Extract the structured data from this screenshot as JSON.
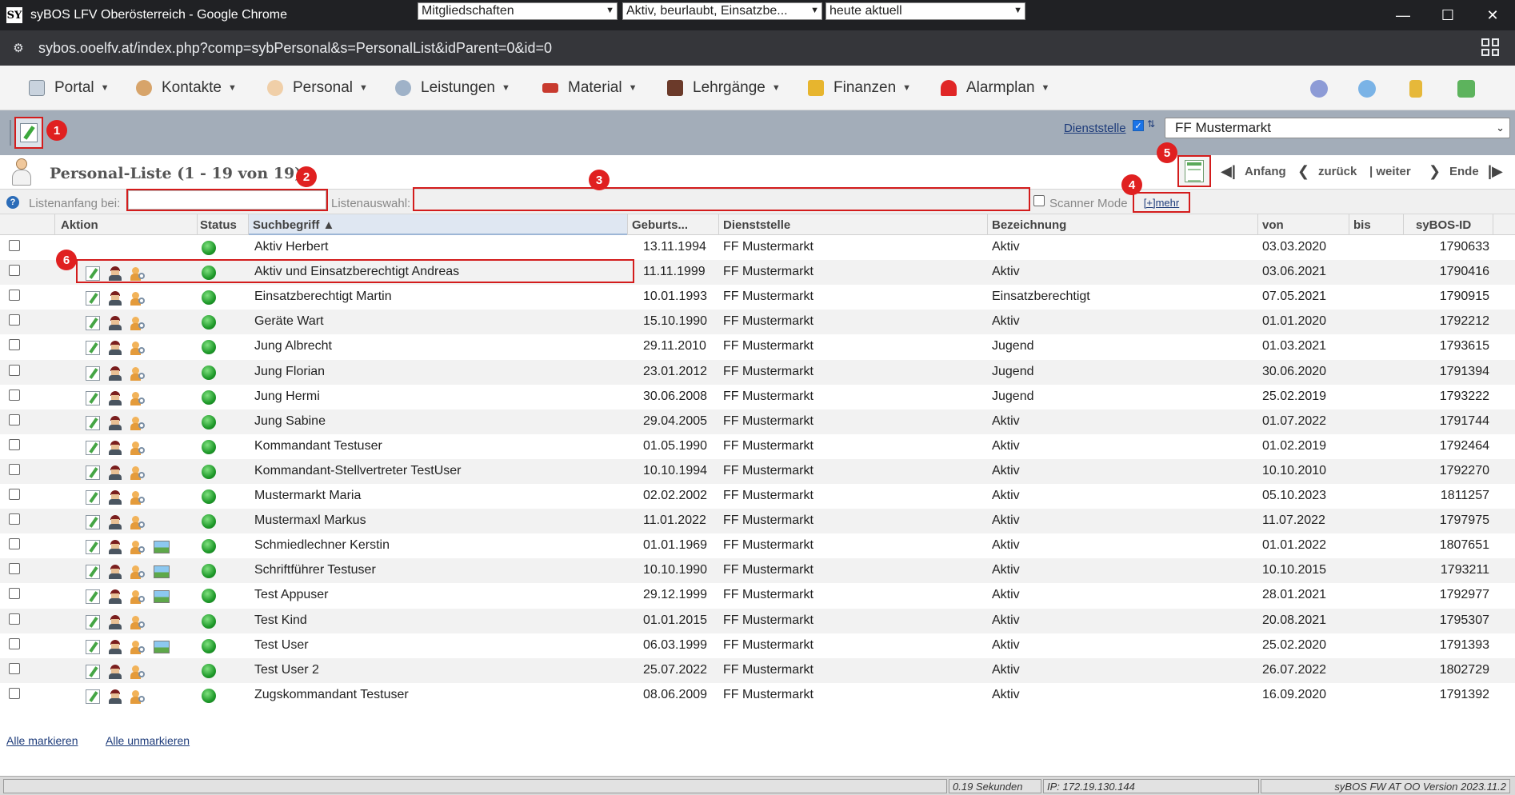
{
  "window": {
    "app_icon": "SY",
    "title": "syBOS LFV Oberösterreich - Google Chrome",
    "url": "sybos.ooelfv.at/index.php?comp=sybPersonal&s=PersonalList&idParent=0&id=0"
  },
  "menu": {
    "items": [
      {
        "label": "Portal",
        "icon": "portal-icon"
      },
      {
        "label": "Kontakte",
        "icon": "contacts-icon"
      },
      {
        "label": "Personal",
        "icon": "personal-icon"
      },
      {
        "label": "Leistungen",
        "icon": "services-icon"
      },
      {
        "label": "Material",
        "icon": "truck-icon"
      },
      {
        "label": "Lehrgänge",
        "icon": "course-icon"
      },
      {
        "label": "Finanzen",
        "icon": "finance-icon"
      },
      {
        "label": "Alarmplan",
        "icon": "alarm-icon"
      }
    ]
  },
  "toolbar": {
    "dienststelle_label": "Dienststelle",
    "dienststelle_value": "FF Mustermarkt",
    "tree_glyph": "⇅"
  },
  "list": {
    "title": "Personal-Liste (1 - 19 von 19)",
    "pager": {
      "first": "Anfang",
      "prev": "zurück",
      "next": "| weiter",
      "last": "Ende"
    }
  },
  "filter": {
    "start_label": "Listenanfang bei:",
    "start_value": "",
    "select_label": "Listenauswahl:",
    "select1": "Mitgliedschaften",
    "select2": "Aktiv, beurlaubt, Einsatzbe...",
    "select3": "heute aktuell",
    "scanner_label": "Scanner Mode",
    "more_label": "[+]mehr"
  },
  "table": {
    "headers": [
      "Aktion",
      "Status",
      "Suchbegriff ▲",
      "Geburts...",
      "Dienststelle",
      "Bezeichnung",
      "von",
      "bis",
      "syBOS-ID"
    ],
    "rows": [
      {
        "name": "Aktiv Herbert",
        "birth": "13.11.1994",
        "unit": "FF Mustermarkt",
        "title": "Aktiv",
        "from": "03.03.2020",
        "to": "",
        "id": "1790633",
        "photo": false,
        "first": true
      },
      {
        "name": "Aktiv und Einsatzberechtigt Andreas",
        "birth": "11.11.1999",
        "unit": "FF Mustermarkt",
        "title": "Aktiv",
        "from": "03.06.2021",
        "to": "",
        "id": "1790416",
        "photo": false
      },
      {
        "name": "Einsatzberechtigt Martin",
        "birth": "10.01.1993",
        "unit": "FF Mustermarkt",
        "title": "Einsatzberechtigt",
        "from": "07.05.2021",
        "to": "",
        "id": "1790915",
        "photo": false
      },
      {
        "name": "Geräte Wart",
        "birth": "15.10.1990",
        "unit": "FF Mustermarkt",
        "title": "Aktiv",
        "from": "01.01.2020",
        "to": "",
        "id": "1792212",
        "photo": false
      },
      {
        "name": "Jung Albrecht",
        "birth": "29.11.2010",
        "unit": "FF Mustermarkt",
        "title": "Jugend",
        "from": "01.03.2021",
        "to": "",
        "id": "1793615",
        "photo": false
      },
      {
        "name": "Jung Florian",
        "birth": "23.01.2012",
        "unit": "FF Mustermarkt",
        "title": "Jugend",
        "from": "30.06.2020",
        "to": "",
        "id": "1791394",
        "photo": false
      },
      {
        "name": "Jung Hermi",
        "birth": "30.06.2008",
        "unit": "FF Mustermarkt",
        "title": "Jugend",
        "from": "25.02.2019",
        "to": "",
        "id": "1793222",
        "photo": false
      },
      {
        "name": "Jung Sabine",
        "birth": "29.04.2005",
        "unit": "FF Mustermarkt",
        "title": "Aktiv",
        "from": "01.07.2022",
        "to": "",
        "id": "1791744",
        "photo": false
      },
      {
        "name": "Kommandant Testuser",
        "birth": "01.05.1990",
        "unit": "FF Mustermarkt",
        "title": "Aktiv",
        "from": "01.02.2019",
        "to": "",
        "id": "1792464",
        "photo": false
      },
      {
        "name": "Kommandant-Stellvertreter TestUser",
        "birth": "10.10.1994",
        "unit": "FF Mustermarkt",
        "title": "Aktiv",
        "from": "10.10.2010",
        "to": "",
        "id": "1792270",
        "photo": false
      },
      {
        "name": "Mustermarkt Maria",
        "birth": "02.02.2002",
        "unit": "FF Mustermarkt",
        "title": "Aktiv",
        "from": "05.10.2023",
        "to": "",
        "id": "1811257",
        "photo": false
      },
      {
        "name": "Mustermaxl Markus",
        "birth": "11.01.2022",
        "unit": "FF Mustermarkt",
        "title": "Aktiv",
        "from": "11.07.2022",
        "to": "",
        "id": "1797975",
        "photo": false
      },
      {
        "name": "Schmiedlechner Kerstin",
        "birth": "01.01.1969",
        "unit": "FF Mustermarkt",
        "title": "Aktiv",
        "from": "01.01.2022",
        "to": "",
        "id": "1807651",
        "photo": true
      },
      {
        "name": "Schriftführer Testuser",
        "birth": "10.10.1990",
        "unit": "FF Mustermarkt",
        "title": "Aktiv",
        "from": "10.10.2015",
        "to": "",
        "id": "1793211",
        "photo": true
      },
      {
        "name": "Test Appuser",
        "birth": "29.12.1999",
        "unit": "FF Mustermarkt",
        "title": "Aktiv",
        "from": "28.01.2021",
        "to": "",
        "id": "1792977",
        "photo": true
      },
      {
        "name": "Test Kind",
        "birth": "01.01.2015",
        "unit": "FF Mustermarkt",
        "title": "Aktiv",
        "from": "20.08.2021",
        "to": "",
        "id": "1795307",
        "photo": false
      },
      {
        "name": "Test User",
        "birth": "06.03.1999",
        "unit": "FF Mustermarkt",
        "title": "Aktiv",
        "from": "25.02.2020",
        "to": "",
        "id": "1791393",
        "photo": true
      },
      {
        "name": "Test User 2",
        "birth": "25.07.2022",
        "unit": "FF Mustermarkt",
        "title": "Aktiv",
        "from": "26.07.2022",
        "to": "",
        "id": "1802729",
        "photo": false
      },
      {
        "name": "Zugskommandant Testuser",
        "birth": "08.06.2009",
        "unit": "FF Mustermarkt",
        "title": "Aktiv",
        "from": "16.09.2020",
        "to": "",
        "id": "1791392",
        "photo": false
      }
    ]
  },
  "footer": {
    "select_all": "Alle markieren",
    "unselect_all": "Alle unmarkieren",
    "time": "0.19 Sekunden",
    "ip": "IP: 172.19.130.144",
    "version": "syBOS FW AT OO Version 2023.11.2"
  },
  "badges": [
    "1",
    "2",
    "3",
    "4",
    "5",
    "6"
  ],
  "colors": {
    "highlight": "#d31c1c",
    "toolbar": "#a3adb9",
    "status_ok": "#1f9a2a",
    "link": "#1d3b7a"
  }
}
